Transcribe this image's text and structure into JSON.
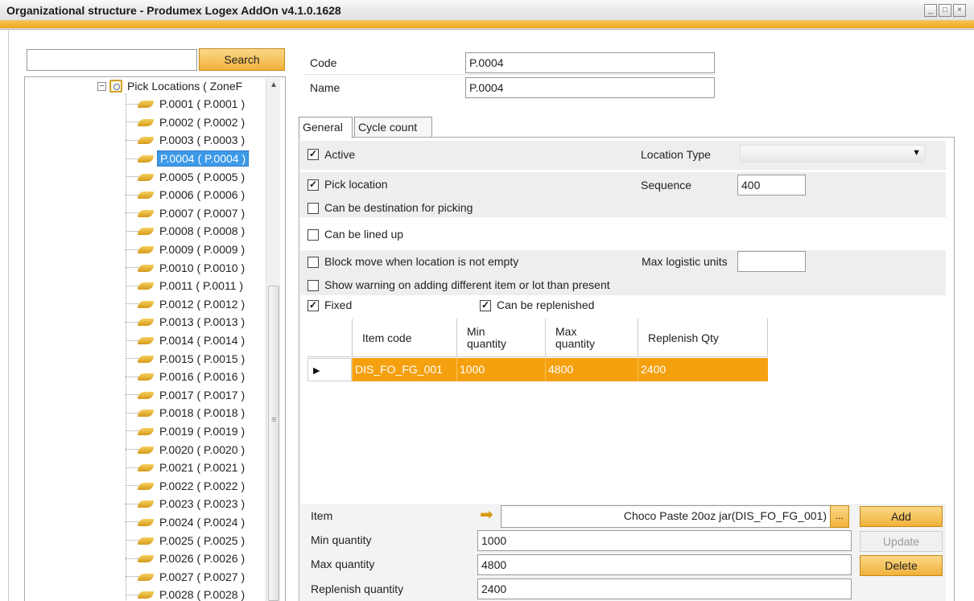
{
  "window": {
    "title": "Organizational structure - Produmex Logex AddOn v4.1.0.1628",
    "min_glyph": "_",
    "max_glyph": "□",
    "close_glyph": "×"
  },
  "search": {
    "value": "",
    "button_label": "Search"
  },
  "tree": {
    "parent_label": "Pick Locations ( ZoneF",
    "expander_glyph": "−",
    "selected": "P.0004 ( P.0004 )",
    "items": [
      "P.0001 ( P.0001 )",
      "P.0002 ( P.0002 )",
      "P.0003 ( P.0003 )",
      "P.0004 ( P.0004 )",
      "P.0005 ( P.0005 )",
      "P.0006 ( P.0006 )",
      "P.0007 ( P.0007 )",
      "P.0008 ( P.0008 )",
      "P.0009 ( P.0009 )",
      "P.0010 ( P.0010 )",
      "P.0011 ( P.0011 )",
      "P.0012 ( P.0012 )",
      "P.0013 ( P.0013 )",
      "P.0014 ( P.0014 )",
      "P.0015 ( P.0015 )",
      "P.0016 ( P.0016 )",
      "P.0017 ( P.0017 )",
      "P.0018 ( P.0018 )",
      "P.0019 ( P.0019 )",
      "P.0020 ( P.0020 )",
      "P.0021 ( P.0021 )",
      "P.0022 ( P.0022 )",
      "P.0023 ( P.0023 )",
      "P.0024 ( P.0024 )",
      "P.0025 ( P.0025 )",
      "P.0026 ( P.0026 )",
      "P.0027 ( P.0027 )",
      "P.0028 ( P.0028 )"
    ]
  },
  "header": {
    "code_label": "Code",
    "code_value": "P.0004",
    "name_label": "Name",
    "name_value": "P.0004"
  },
  "tabs": [
    {
      "label": "General"
    },
    {
      "label": "Cycle count"
    }
  ],
  "general": {
    "active_label": "Active",
    "active_checked": true,
    "location_type_label": "Location Type",
    "location_type_value": "",
    "pick_location_label": "Pick location",
    "pick_location_checked": true,
    "sequence_label": "Sequence",
    "sequence_value": "400",
    "destination_label": "Can be destination for picking",
    "destination_checked": false,
    "lined_up_label": "Can be lined up",
    "lined_up_checked": false,
    "block_move_label": "Block move when location is not empty",
    "block_move_checked": false,
    "max_units_label": "Max logistic units",
    "max_units_value": "",
    "show_warning_label": "Show warning on adding different item or lot than present",
    "show_warning_checked": false,
    "fixed_label": "Fixed",
    "fixed_checked": true,
    "replenished_label": "Can be replenished",
    "replenished_checked": true
  },
  "grid": {
    "columns": [
      "Item code",
      "Min quantity",
      "Max quantity",
      "Replenish Qty"
    ],
    "col_min_line1": "Min",
    "col_min_line2": "quantity",
    "col_max_line1": "Max",
    "col_max_line2": "quantity",
    "rows": [
      {
        "item_code": "DIS_FO_FG_001",
        "min": "1000",
        "max": "4800",
        "replenish": "2400"
      }
    ]
  },
  "editor": {
    "item_label": "Item",
    "item_value": "Choco Paste 20oz jar(DIS_FO_FG_001)",
    "min_label": "Min quantity",
    "min_value": "1000",
    "max_label": "Max quantity",
    "max_value": "4800",
    "replenish_label": "Replenish quantity",
    "replenish_value": "2400",
    "browse_label": "...",
    "add_label": "Add",
    "update_label": "Update",
    "delete_label": "Delete"
  },
  "colors": {
    "accent": "#f1a51c",
    "selected_row": "#f5a00f",
    "tree_selected": "#3d9ae8"
  },
  "icons": {
    "check": "✓",
    "dropdown_arrow": "▼",
    "row_pointer": "▶",
    "go_arrow": "➡",
    "scroll_up": "▲",
    "scroll_grip": "≡"
  }
}
